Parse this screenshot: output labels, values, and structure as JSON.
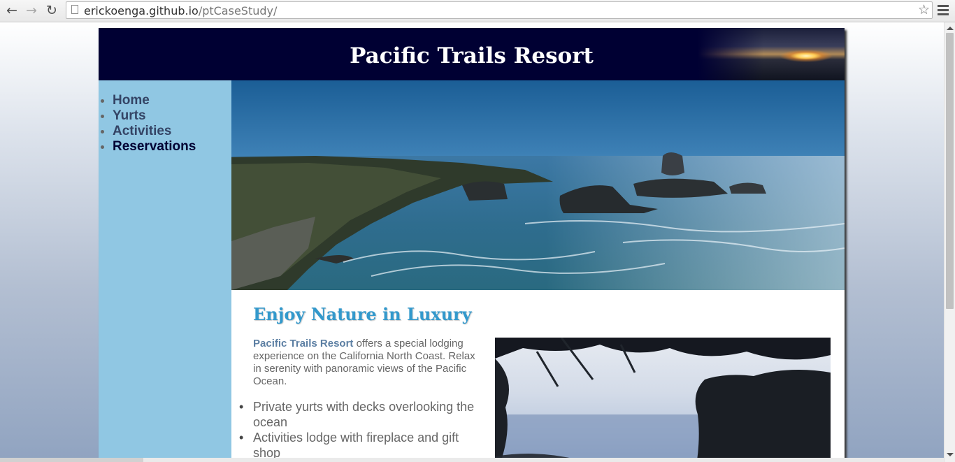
{
  "browser": {
    "back_icon": "arrow-left-icon",
    "forward_icon": "arrow-right-icon",
    "reload_icon": "reload-icon",
    "url_host": "erickoenga.github.io",
    "url_path": "/ptCaseStudy/",
    "bookmark_icon": "star-icon",
    "menu_icon": "hamburger-menu-icon"
  },
  "site": {
    "title": "Pacific Trails Resort"
  },
  "nav": {
    "items": [
      {
        "label": "Home"
      },
      {
        "label": "Yurts"
      },
      {
        "label": "Activities"
      },
      {
        "label": "Reservations"
      }
    ]
  },
  "main": {
    "heading": "Enjoy Nature in Luxury",
    "intro_brand": "Pacific Trails Resort",
    "intro_text": " offers a special lodging experience on the California North Coast. Relax in serenity with panoramic views of the Pacific Ocean.",
    "features": [
      "Private yurts with decks overlooking the ocean",
      "Activities lodge with fireplace and gift shop"
    ]
  },
  "colors": {
    "header_bg": "#000033",
    "nav_bg": "#90c7e3",
    "heading": "#3399cc",
    "nav_link": "#344465",
    "brand_text": "#5c7fa3"
  }
}
